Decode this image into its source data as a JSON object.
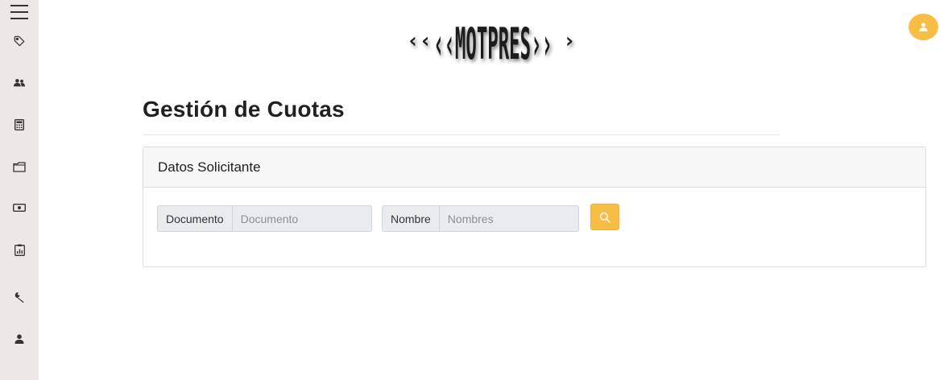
{
  "sidebar": {
    "items": [
      {
        "icon": "tag-icon"
      },
      {
        "icon": "users-icon"
      },
      {
        "icon": "calculator-icon"
      },
      {
        "icon": "folder-icon"
      },
      {
        "icon": "money-icon"
      },
      {
        "icon": "clipboard-report-icon"
      },
      {
        "icon": "wrench-icon"
      },
      {
        "icon": "user-icon"
      }
    ]
  },
  "header": {
    "logo_text": "‹‹MOTPRES››",
    "avatar_icon": "user-icon"
  },
  "page": {
    "title": "Gestión de Cuotas"
  },
  "card": {
    "title": "Datos Solicitante",
    "documento": {
      "label": "Documento",
      "placeholder": "Documento",
      "value": ""
    },
    "nombre": {
      "label": "Nombre",
      "placeholder": "Nombres",
      "value": ""
    },
    "search_icon": "search-icon"
  },
  "colors": {
    "accent": "#f7bd45",
    "sidebar_bg": "#ede8e6",
    "card_header_bg": "#f7f7f7",
    "input_bg": "#e9ecef"
  }
}
